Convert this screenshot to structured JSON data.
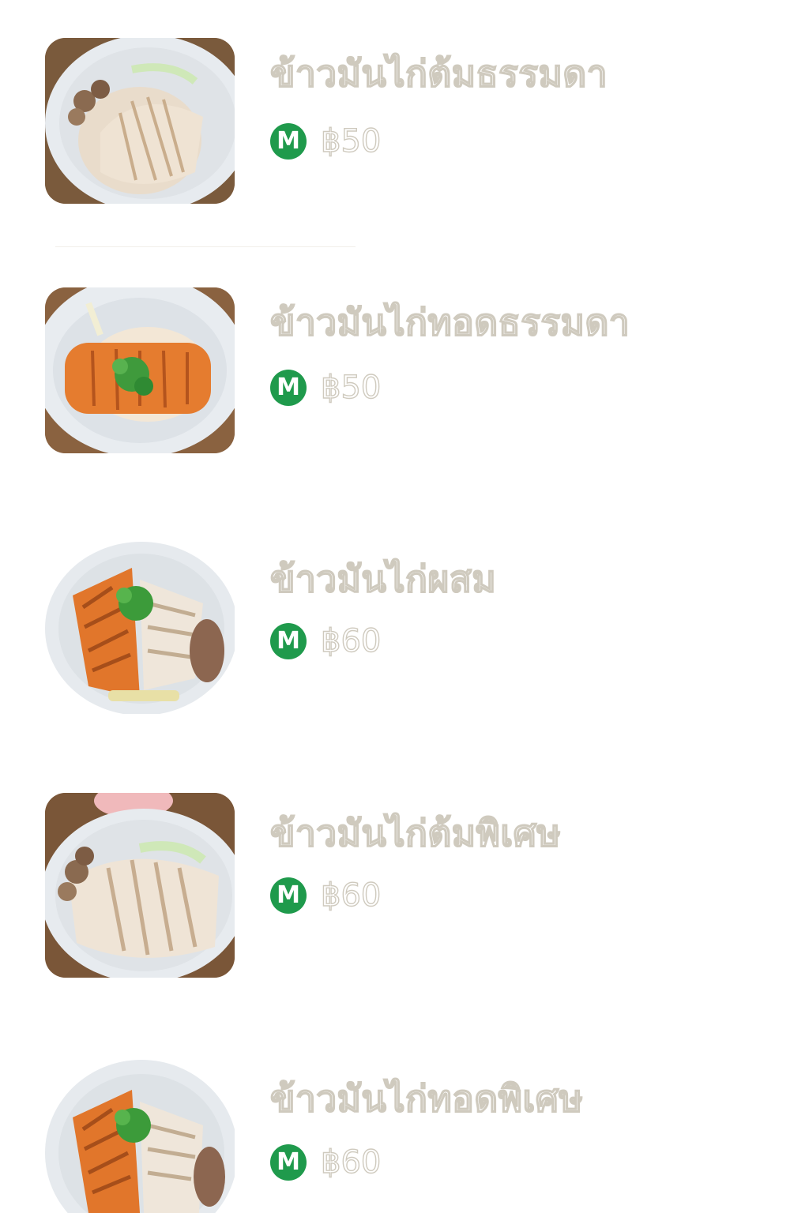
{
  "menu": {
    "items": [
      {
        "name": "ข้าวมันไก่ต้มธรรมดา",
        "price": "฿50",
        "badge": "M",
        "image": "boiled-chicken-rice-photo"
      },
      {
        "name": "ข้าวมันไก่ทอดธรรมดา",
        "price": "฿50",
        "badge": "M",
        "image": "fried-chicken-rice-photo"
      },
      {
        "name": "ข้าวมันไก่ผสม",
        "price": "฿60",
        "badge": "M",
        "image": "mixed-chicken-rice-photo"
      },
      {
        "name": "ข้าวมันไก่ต้มพิเศษ",
        "price": "฿60",
        "badge": "M",
        "image": "special-boiled-chicken-rice-photo"
      },
      {
        "name": "ข้าวมันไก่ทอดพิเศษ",
        "price": "฿60",
        "badge": "M",
        "image": "special-fried-chicken-rice-photo"
      }
    ]
  },
  "colors": {
    "badge": "#1f9a4c",
    "text_outline": "#cfcabe",
    "background": "#ffffff"
  }
}
